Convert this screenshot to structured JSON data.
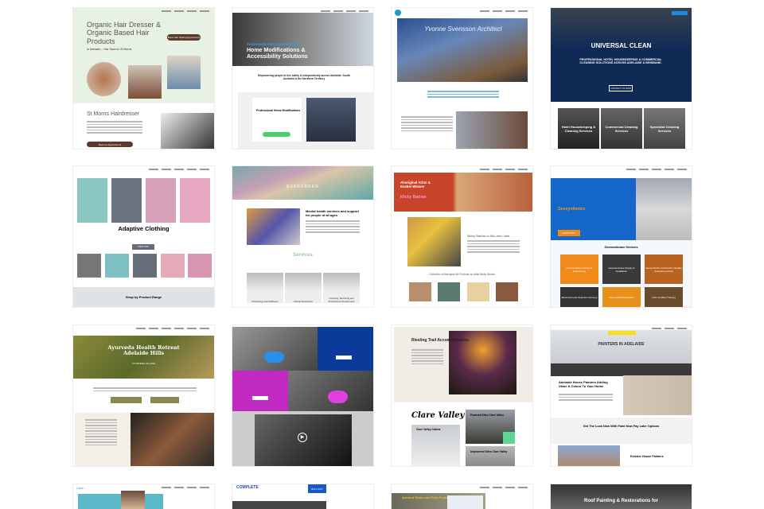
{
  "thumbs": [
    {
      "title": "Organic Hair Dresser & Organic Based Hair Products",
      "subtitle": "In Adelaide – Hair Salon in St Morris",
      "button": "Book Hair Styling Appointment",
      "heading2": "St Morris Hairdresser",
      "button2": "Book an Appointment"
    },
    {
      "kicker": "Trademarks Home Modifications",
      "title": "Home Modifications & Accessibility Solutions",
      "tagline": "Empowering people to live safely & independently across Adelaide, South Australia & the Northern Territory",
      "card_title": "Professional Home Modifications"
    },
    {
      "title": "Yvonne Svensson Architect"
    },
    {
      "title": "UNIVERSAL CLEAN",
      "subtitle": "PROFESSIONAL HOTEL HOUSEKEEPING & COMMERCIAL CLEANING SOLUTIONS ACROSS ADELAIDE & BRISBANE.",
      "button": "CONTACT US NOW",
      "cards": [
        "Hotel Housekeeping & Cleaning Services",
        "Commercial Cleaning Services",
        "Specialist Cleaning Services"
      ]
    },
    {
      "title": "Adaptive Clothing",
      "button": "SHOP NOW",
      "band": "Shop by Product Range"
    },
    {
      "logo": "EVERGREEN",
      "title": "Mental health services and support for people of all ages",
      "section": "Services",
      "cards": [
        "Psychology and Wellbeing",
        "Clinical Supervision",
        "Coaching, Mentoring and Professional Development"
      ]
    },
    {
      "title": "Aboriginal Artist & Basket Weaver",
      "name": "Micky Barlow",
      "heading2": "Micky Barlow in McLaren Vale",
      "collection": "Collection of Aboriginal Art Products by Artist Micky Barlow"
    },
    {
      "title": "Geosynthetics",
      "button": "LEARN MORE",
      "section": "Geomembrane Services",
      "cards": [
        "Geomembrane Design & Engineering",
        "Geomembrane Supply & Installation",
        "Geosynthetic Construction Quality Assurance (CQA)",
        "Electrical Leak Detection Surveys",
        "Geomembrane Repairs",
        "IAGI Certified Training"
      ]
    },
    {
      "title": "Ayurveda Health Retreat Adelaide Hills",
      "subtitle": "AYURVEDA VILLAGE"
    },
    {
      "play": "▶"
    },
    {
      "title": "Riesling Trail Accommodation",
      "script": "Clare Valley",
      "cards": [
        "Clare Valley Cabins",
        "Powered Sites Clare Valley",
        "Unpowered Sites Clare Valley"
      ]
    },
    {
      "title": "PAINTERS IN ADELAIDE",
      "heading2": "Adelaide House Painters Adding Value & Colour To Your Home",
      "band": "Get The Look Now With Paint Now Pay Later Options",
      "heading3": "Exterior House Painters"
    },
    {
      "logo": "Care"
    },
    {
      "logo": "COMPLETE",
      "phone": "8271 4767"
    },
    {
      "title": "Amberd Tanks and Poly Products"
    },
    {
      "title": "Roof Painting & Restorations for"
    }
  ]
}
